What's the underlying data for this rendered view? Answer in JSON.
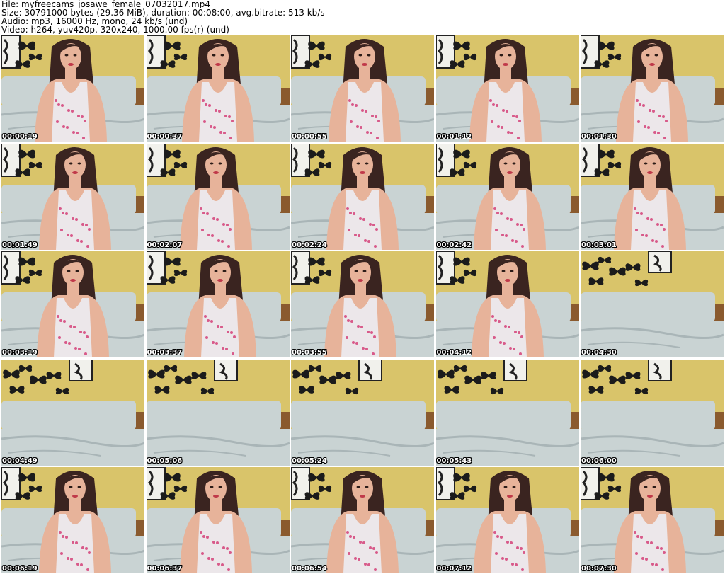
{
  "header": {
    "file": "File: myfreecams_josawe_female_07032017.mp4",
    "size": "Size: 30791000 bytes (29.36 MiB), duration: 00:08:00, avg.bitrate: 513 kb/s",
    "audio": "Audio: mp3, 16000 Hz, mono, 24 kb/s (und)",
    "video": "Video: h264, yuv420p, 320x240, 1000.00 fps(r) (und)"
  },
  "colors": {
    "wall": "#d9c46a",
    "sofa": "#c9d3d3",
    "sofa_shadow": "#a9b5b7",
    "skin": "#e7b39a",
    "hair": "#3a2420",
    "top": "#ece7ea",
    "butterfly": "#1b1b1b"
  },
  "thumbnails": [
    {
      "time": "00:00:19",
      "person": true
    },
    {
      "time": "00:00:37",
      "person": true
    },
    {
      "time": "00:00:55",
      "person": true
    },
    {
      "time": "00:01:12",
      "person": true
    },
    {
      "time": "00:01:30",
      "person": true
    },
    {
      "time": "00:01:49",
      "person": true
    },
    {
      "time": "00:02:07",
      "person": true
    },
    {
      "time": "00:02:24",
      "person": true
    },
    {
      "time": "00:02:42",
      "person": true
    },
    {
      "time": "00:03:01",
      "person": true
    },
    {
      "time": "00:03:19",
      "person": true
    },
    {
      "time": "00:03:37",
      "person": true
    },
    {
      "time": "00:03:55",
      "person": true
    },
    {
      "time": "00:04:12",
      "person": true
    },
    {
      "time": "00:04:30",
      "person": false
    },
    {
      "time": "00:04:49",
      "person": false
    },
    {
      "time": "00:05:06",
      "person": false
    },
    {
      "time": "00:05:24",
      "person": false
    },
    {
      "time": "00:05:43",
      "person": false
    },
    {
      "time": "00:06:00",
      "person": false
    },
    {
      "time": "00:06:19",
      "person": true
    },
    {
      "time": "00:06:37",
      "person": true
    },
    {
      "time": "00:06:54",
      "person": true
    },
    {
      "time": "00:07:12",
      "person": true
    },
    {
      "time": "00:07:30",
      "person": true
    }
  ]
}
